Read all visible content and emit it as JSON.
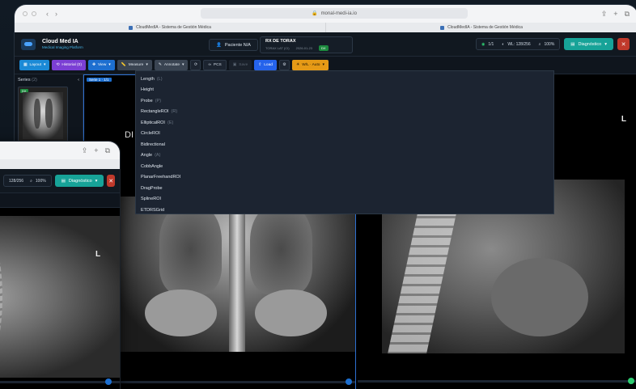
{
  "browser": {
    "address": "monal-medi-ia.io",
    "tabs": [
      {
        "label": "CloudMedIA - Sistema de Gestión Médica"
      },
      {
        "label": "CloudMedIA - Sistema de Gestión Médica"
      }
    ]
  },
  "app": {
    "title": "Cloud Med IA",
    "subtitle": "Medical Imaging Platform"
  },
  "patient": {
    "label": "Paciente N/A"
  },
  "study": {
    "name": "RX DE TORAX",
    "detail": "TORAX LAT (CI)",
    "date": "2026-01-23",
    "badge": "DX"
  },
  "header_right": {
    "series_count": "1/1",
    "wl": "WL: 128/256",
    "zoom": "100%",
    "diagnostic_label": "Diagnóstico",
    "close_label": "✕"
  },
  "toolbar": {
    "layout": "Layout",
    "history": "Historial (0)",
    "view": "View",
    "measure": "Measure",
    "annotate": "Annotate",
    "pcs": "PCS",
    "save": "Save",
    "load": "Load",
    "wl": "W/L · Auto"
  },
  "sidebar": {
    "title": "Series",
    "count": "(2)",
    "thumb_tag": "DX"
  },
  "viewport": {
    "label": "Serie 1 · 1/1",
    "orientation_left": "DI",
    "orientation_right": "L"
  },
  "measure_menu": {
    "items": [
      {
        "label": "Length",
        "key": "(L)"
      },
      {
        "label": "Height",
        "key": ""
      },
      {
        "label": "Probe",
        "key": "(P)"
      },
      {
        "label": "RectangleROI",
        "key": "(R)"
      },
      {
        "label": "EllipticalROI",
        "key": "(E)"
      },
      {
        "label": "CircleROI",
        "key": ""
      },
      {
        "label": "Bidirectional",
        "key": ""
      },
      {
        "label": "Angle",
        "key": "(A)"
      },
      {
        "label": "CobbAngle",
        "key": ""
      },
      {
        "label": "PlanarFreehandROI",
        "key": ""
      },
      {
        "label": "DragProbe",
        "key": ""
      },
      {
        "label": "SplineROI",
        "key": ""
      },
      {
        "label": "ETDRSGrid",
        "key": ""
      }
    ]
  },
  "second_window": {
    "wl": "128/256",
    "zoom": "100%",
    "diagnostic_label": "Diagnóstico",
    "close_label": "✕",
    "orientation": "L"
  },
  "colors": {
    "accent_teal": "#17a398",
    "danger": "#c0392b",
    "warning": "#e69a16",
    "primary": "#1d6fd0"
  }
}
